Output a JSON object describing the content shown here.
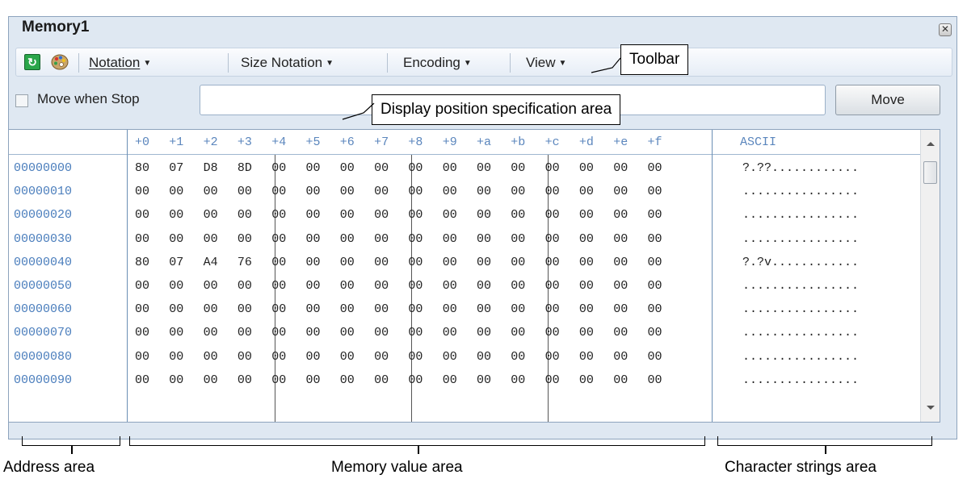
{
  "window": {
    "title": "Memory1"
  },
  "toolbar": {
    "menus": [
      "Notation",
      "Size Notation",
      "Encoding",
      "View"
    ]
  },
  "position": {
    "checkbox_label": "Move when Stop",
    "input_value": "",
    "move_label": "Move"
  },
  "memory": {
    "column_headers": [
      "+0",
      "+1",
      "+2",
      "+3",
      "+4",
      "+5",
      "+6",
      "+7",
      "+8",
      "+9",
      "+a",
      "+b",
      "+c",
      "+d",
      "+e",
      "+f"
    ],
    "ascii_header": "ASCII",
    "rows": [
      {
        "address": "00000000",
        "bytes": [
          "80",
          "07",
          "D8",
          "8D",
          "00",
          "00",
          "00",
          "00",
          "00",
          "00",
          "00",
          "00",
          "00",
          "00",
          "00",
          "00"
        ],
        "ascii": "?.??............"
      },
      {
        "address": "00000010",
        "bytes": [
          "00",
          "00",
          "00",
          "00",
          "00",
          "00",
          "00",
          "00",
          "00",
          "00",
          "00",
          "00",
          "00",
          "00",
          "00",
          "00"
        ],
        "ascii": "................"
      },
      {
        "address": "00000020",
        "bytes": [
          "00",
          "00",
          "00",
          "00",
          "00",
          "00",
          "00",
          "00",
          "00",
          "00",
          "00",
          "00",
          "00",
          "00",
          "00",
          "00"
        ],
        "ascii": "................"
      },
      {
        "address": "00000030",
        "bytes": [
          "00",
          "00",
          "00",
          "00",
          "00",
          "00",
          "00",
          "00",
          "00",
          "00",
          "00",
          "00",
          "00",
          "00",
          "00",
          "00"
        ],
        "ascii": "................"
      },
      {
        "address": "00000040",
        "bytes": [
          "80",
          "07",
          "A4",
          "76",
          "00",
          "00",
          "00",
          "00",
          "00",
          "00",
          "00",
          "00",
          "00",
          "00",
          "00",
          "00"
        ],
        "ascii": "?.?v............"
      },
      {
        "address": "00000050",
        "bytes": [
          "00",
          "00",
          "00",
          "00",
          "00",
          "00",
          "00",
          "00",
          "00",
          "00",
          "00",
          "00",
          "00",
          "00",
          "00",
          "00"
        ],
        "ascii": "................"
      },
      {
        "address": "00000060",
        "bytes": [
          "00",
          "00",
          "00",
          "00",
          "00",
          "00",
          "00",
          "00",
          "00",
          "00",
          "00",
          "00",
          "00",
          "00",
          "00",
          "00"
        ],
        "ascii": "................"
      },
      {
        "address": "00000070",
        "bytes": [
          "00",
          "00",
          "00",
          "00",
          "00",
          "00",
          "00",
          "00",
          "00",
          "00",
          "00",
          "00",
          "00",
          "00",
          "00",
          "00"
        ],
        "ascii": "................"
      },
      {
        "address": "00000080",
        "bytes": [
          "00",
          "00",
          "00",
          "00",
          "00",
          "00",
          "00",
          "00",
          "00",
          "00",
          "00",
          "00",
          "00",
          "00",
          "00",
          "00"
        ],
        "ascii": "................"
      },
      {
        "address": "00000090",
        "bytes": [
          "00",
          "00",
          "00",
          "00",
          "00",
          "00",
          "00",
          "00",
          "00",
          "00",
          "00",
          "00",
          "00",
          "00",
          "00",
          "00"
        ],
        "ascii": "................"
      }
    ]
  },
  "callouts": {
    "toolbar": "Toolbar",
    "display_position": "Display position specification area",
    "address_area": "Address area",
    "memory_value_area": "Memory value area",
    "character_strings_area": "Character strings area"
  },
  "icons": {
    "refresh": "refresh-icon",
    "palette": "palette-icon",
    "close": "close-icon"
  }
}
